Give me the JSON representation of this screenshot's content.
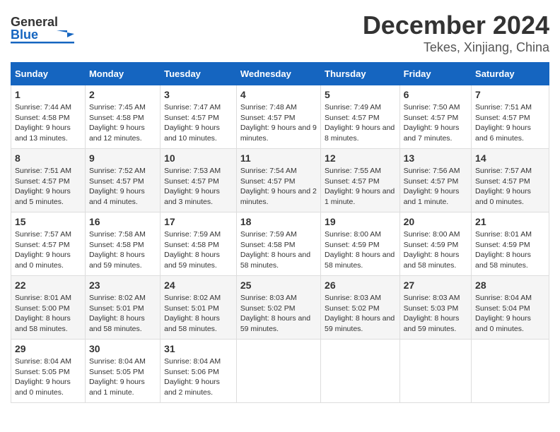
{
  "header": {
    "logo_line1": "General",
    "logo_line2": "Blue",
    "title": "December 2024",
    "subtitle": "Tekes, Xinjiang, China"
  },
  "days_of_week": [
    "Sunday",
    "Monday",
    "Tuesday",
    "Wednesday",
    "Thursday",
    "Friday",
    "Saturday"
  ],
  "weeks": [
    [
      {
        "day": 1,
        "sunrise": "7:44 AM",
        "sunset": "4:58 PM",
        "daylight": "9 hours and 13 minutes."
      },
      {
        "day": 2,
        "sunrise": "7:45 AM",
        "sunset": "4:58 PM",
        "daylight": "9 hours and 12 minutes."
      },
      {
        "day": 3,
        "sunrise": "7:47 AM",
        "sunset": "4:57 PM",
        "daylight": "9 hours and 10 minutes."
      },
      {
        "day": 4,
        "sunrise": "7:48 AM",
        "sunset": "4:57 PM",
        "daylight": "9 hours and 9 minutes."
      },
      {
        "day": 5,
        "sunrise": "7:49 AM",
        "sunset": "4:57 PM",
        "daylight": "9 hours and 8 minutes."
      },
      {
        "day": 6,
        "sunrise": "7:50 AM",
        "sunset": "4:57 PM",
        "daylight": "9 hours and 7 minutes."
      },
      {
        "day": 7,
        "sunrise": "7:51 AM",
        "sunset": "4:57 PM",
        "daylight": "9 hours and 6 minutes."
      }
    ],
    [
      {
        "day": 8,
        "sunrise": "7:51 AM",
        "sunset": "4:57 PM",
        "daylight": "9 hours and 5 minutes."
      },
      {
        "day": 9,
        "sunrise": "7:52 AM",
        "sunset": "4:57 PM",
        "daylight": "9 hours and 4 minutes."
      },
      {
        "day": 10,
        "sunrise": "7:53 AM",
        "sunset": "4:57 PM",
        "daylight": "9 hours and 3 minutes."
      },
      {
        "day": 11,
        "sunrise": "7:54 AM",
        "sunset": "4:57 PM",
        "daylight": "9 hours and 2 minutes."
      },
      {
        "day": 12,
        "sunrise": "7:55 AM",
        "sunset": "4:57 PM",
        "daylight": "9 hours and 1 minute."
      },
      {
        "day": 13,
        "sunrise": "7:56 AM",
        "sunset": "4:57 PM",
        "daylight": "9 hours and 1 minute."
      },
      {
        "day": 14,
        "sunrise": "7:57 AM",
        "sunset": "4:57 PM",
        "daylight": "9 hours and 0 minutes."
      }
    ],
    [
      {
        "day": 15,
        "sunrise": "7:57 AM",
        "sunset": "4:57 PM",
        "daylight": "9 hours and 0 minutes."
      },
      {
        "day": 16,
        "sunrise": "7:58 AM",
        "sunset": "4:58 PM",
        "daylight": "8 hours and 59 minutes."
      },
      {
        "day": 17,
        "sunrise": "7:59 AM",
        "sunset": "4:58 PM",
        "daylight": "8 hours and 59 minutes."
      },
      {
        "day": 18,
        "sunrise": "7:59 AM",
        "sunset": "4:58 PM",
        "daylight": "8 hours and 58 minutes."
      },
      {
        "day": 19,
        "sunrise": "8:00 AM",
        "sunset": "4:59 PM",
        "daylight": "8 hours and 58 minutes."
      },
      {
        "day": 20,
        "sunrise": "8:00 AM",
        "sunset": "4:59 PM",
        "daylight": "8 hours and 58 minutes."
      },
      {
        "day": 21,
        "sunrise": "8:01 AM",
        "sunset": "4:59 PM",
        "daylight": "8 hours and 58 minutes."
      }
    ],
    [
      {
        "day": 22,
        "sunrise": "8:01 AM",
        "sunset": "5:00 PM",
        "daylight": "8 hours and 58 minutes."
      },
      {
        "day": 23,
        "sunrise": "8:02 AM",
        "sunset": "5:01 PM",
        "daylight": "8 hours and 58 minutes."
      },
      {
        "day": 24,
        "sunrise": "8:02 AM",
        "sunset": "5:01 PM",
        "daylight": "8 hours and 58 minutes."
      },
      {
        "day": 25,
        "sunrise": "8:03 AM",
        "sunset": "5:02 PM",
        "daylight": "8 hours and 59 minutes."
      },
      {
        "day": 26,
        "sunrise": "8:03 AM",
        "sunset": "5:02 PM",
        "daylight": "8 hours and 59 minutes."
      },
      {
        "day": 27,
        "sunrise": "8:03 AM",
        "sunset": "5:03 PM",
        "daylight": "8 hours and 59 minutes."
      },
      {
        "day": 28,
        "sunrise": "8:04 AM",
        "sunset": "5:04 PM",
        "daylight": "9 hours and 0 minutes."
      }
    ],
    [
      {
        "day": 29,
        "sunrise": "8:04 AM",
        "sunset": "5:05 PM",
        "daylight": "9 hours and 0 minutes."
      },
      {
        "day": 30,
        "sunrise": "8:04 AM",
        "sunset": "5:05 PM",
        "daylight": "9 hours and 1 minute."
      },
      {
        "day": 31,
        "sunrise": "8:04 AM",
        "sunset": "5:06 PM",
        "daylight": "9 hours and 2 minutes."
      },
      null,
      null,
      null,
      null
    ]
  ]
}
